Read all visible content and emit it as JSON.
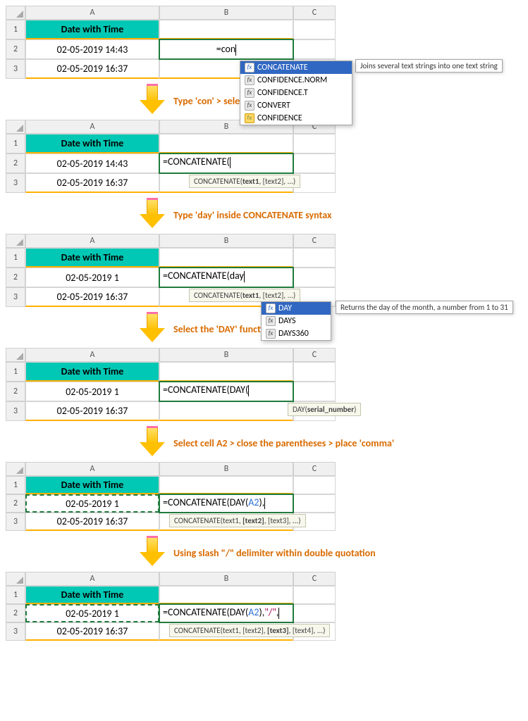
{
  "columns": {
    "A": "A",
    "B": "B",
    "C": "C"
  },
  "rows": {
    "r1": "1",
    "r2": "2",
    "r3": "3"
  },
  "header_title": "Date with Time",
  "dates": {
    "a2_full": "02-05-2019 14:43",
    "a3_full": "02-05-2019 16:37",
    "a2_trunc": "02-05-2019 1"
  },
  "step1": {
    "formula": "=con",
    "tooltip": "Joins several text strings into one text string",
    "dropdown": [
      {
        "label": "CONCATENATE",
        "selected": true,
        "icon": "fx"
      },
      {
        "label": "CONFIDENCE.NORM",
        "selected": false,
        "icon": "fx"
      },
      {
        "label": "CONFIDENCE.T",
        "selected": false,
        "icon": "fx"
      },
      {
        "label": "CONVERT",
        "selected": false,
        "icon": "fx"
      },
      {
        "label": "CONFIDENCE",
        "selected": false,
        "icon": "warn"
      }
    ]
  },
  "instr": {
    "i1": "Type 'con' > select the function > press 'Tab'",
    "i2": "Type 'day' inside CONCATENATE syntax",
    "i3": "Select the 'DAY' function > press 'Tab'",
    "i4": "Select cell A2 > close the parentheses > place 'comma'",
    "i5": "Using slash \"/\" delimiter within double quotation"
  },
  "step2": {
    "formula": "=CONCATENATE(",
    "hint_pre": "CONCATENATE(",
    "hint_bold": "text1",
    "hint_post": ", [text2], ...)"
  },
  "step3": {
    "formula": "=CONCATENATE(day",
    "hint_pre": "CONCATENATE(",
    "hint_bold": "text1",
    "hint_post": ", [text2], ...)",
    "tooltip": "Returns the day of the month, a number from 1 to 31",
    "dropdown": [
      {
        "label": "DAY",
        "selected": true,
        "icon": "fx"
      },
      {
        "label": "DAYS",
        "selected": false,
        "icon": "fx"
      },
      {
        "label": "DAYS360",
        "selected": false,
        "icon": "fx"
      }
    ]
  },
  "step4": {
    "formula_pre": "=CONCATENATE(DAY(",
    "hint_pre": "DAY(",
    "hint_bold": "serial_number",
    "hint_post": ")"
  },
  "step5": {
    "formula_pre": "=CONCATENATE(DAY(",
    "formula_ref": "A2",
    "formula_post": "),",
    "hint_pre": "CONCATENATE(text1, ",
    "hint_bold": "[text2]",
    "hint_post": ", [text3], ...)"
  },
  "step6": {
    "formula_pre": "=CONCATENATE(DAY(",
    "formula_ref": "A2",
    "formula_mid": "),",
    "formula_str": "\"/\"",
    "formula_post": ",",
    "hint_pre": "CONCATENATE(text1, [text2], ",
    "hint_bold": "[text3]",
    "hint_post": ", [text4], ...)"
  }
}
